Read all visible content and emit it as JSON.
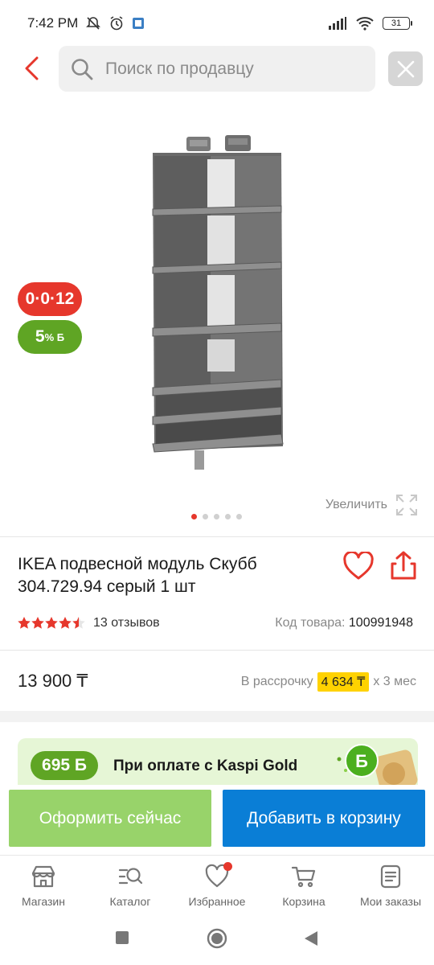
{
  "status_bar": {
    "time": "7:42 PM",
    "battery": "31"
  },
  "header": {
    "search_placeholder": "Поиск по продавцу"
  },
  "gallery": {
    "badge_installment": "0·0·12",
    "badge_bonus_value": "5",
    "badge_bonus_suffix": "% Б",
    "zoom_label": "Увеличить",
    "dots_total": 5,
    "dots_active": 1
  },
  "product": {
    "title": "IKEA подвесной модуль Скубб 304.729.94 серый 1 шт",
    "rating_stars": 4.5,
    "reviews": "13 отзывов",
    "sku_label": "Код товара:",
    "sku_value": "100991948"
  },
  "price": {
    "value": "13 900 ₸",
    "installment_label": "В рассрочку",
    "installment_amount": "4 634 ₸",
    "installment_term": "х 3 мес"
  },
  "promo": {
    "bonus": "695 Б",
    "text": "При оплате с Kaspi Gold"
  },
  "actions": {
    "buy_now": "Оформить сейчас",
    "add_to_cart": "Добавить в корзину"
  },
  "bottom_nav": {
    "items": [
      {
        "label": "Магазин",
        "icon": "store-icon"
      },
      {
        "label": "Каталог",
        "icon": "catalog-search-icon"
      },
      {
        "label": "Избранное",
        "icon": "heart-icon"
      },
      {
        "label": "Корзина",
        "icon": "cart-icon"
      },
      {
        "label": "Мои заказы",
        "icon": "orders-icon"
      }
    ]
  },
  "colors": {
    "accent_red": "#e6372c",
    "green": "#5fa524",
    "blue": "#0a7ed6",
    "light_green": "#98d36a",
    "yellow": "#ffd200"
  }
}
